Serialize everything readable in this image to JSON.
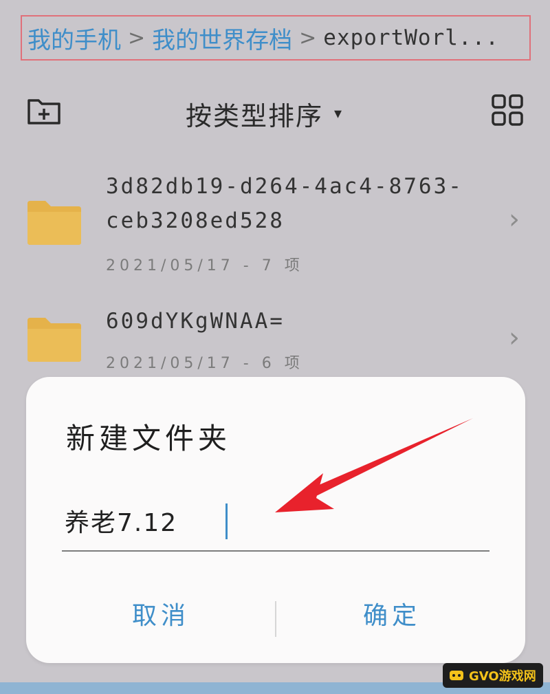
{
  "breadcrumb": {
    "items": [
      "我的手机",
      "我的世界存档"
    ],
    "current": "exportWorl...",
    "separator": ">"
  },
  "toolbar": {
    "sort_label": "按类型排序",
    "sort_caret": "▾",
    "new_folder_icon": "new-folder-icon",
    "view_icon": "grid-view-icon"
  },
  "files": [
    {
      "name": "3d82db19-d264-4ac4-8763-ceb3208ed528",
      "meta": "2021/05/17 - 7 项"
    },
    {
      "name": "609dYKgWNAA=",
      "meta": "2021/05/17 - 6 项"
    }
  ],
  "dialog": {
    "title": "新建文件夹",
    "input_value": "养老7.12",
    "cancel_label": "取消",
    "ok_label": "确定"
  },
  "watermark": {
    "text": "GVO游戏网"
  },
  "colors": {
    "accent": "#3f8ec9",
    "highlight_border": "#e0707a",
    "folder": "#e5b24a",
    "arrow": "#e8222c",
    "background": "#c9c6cb"
  }
}
